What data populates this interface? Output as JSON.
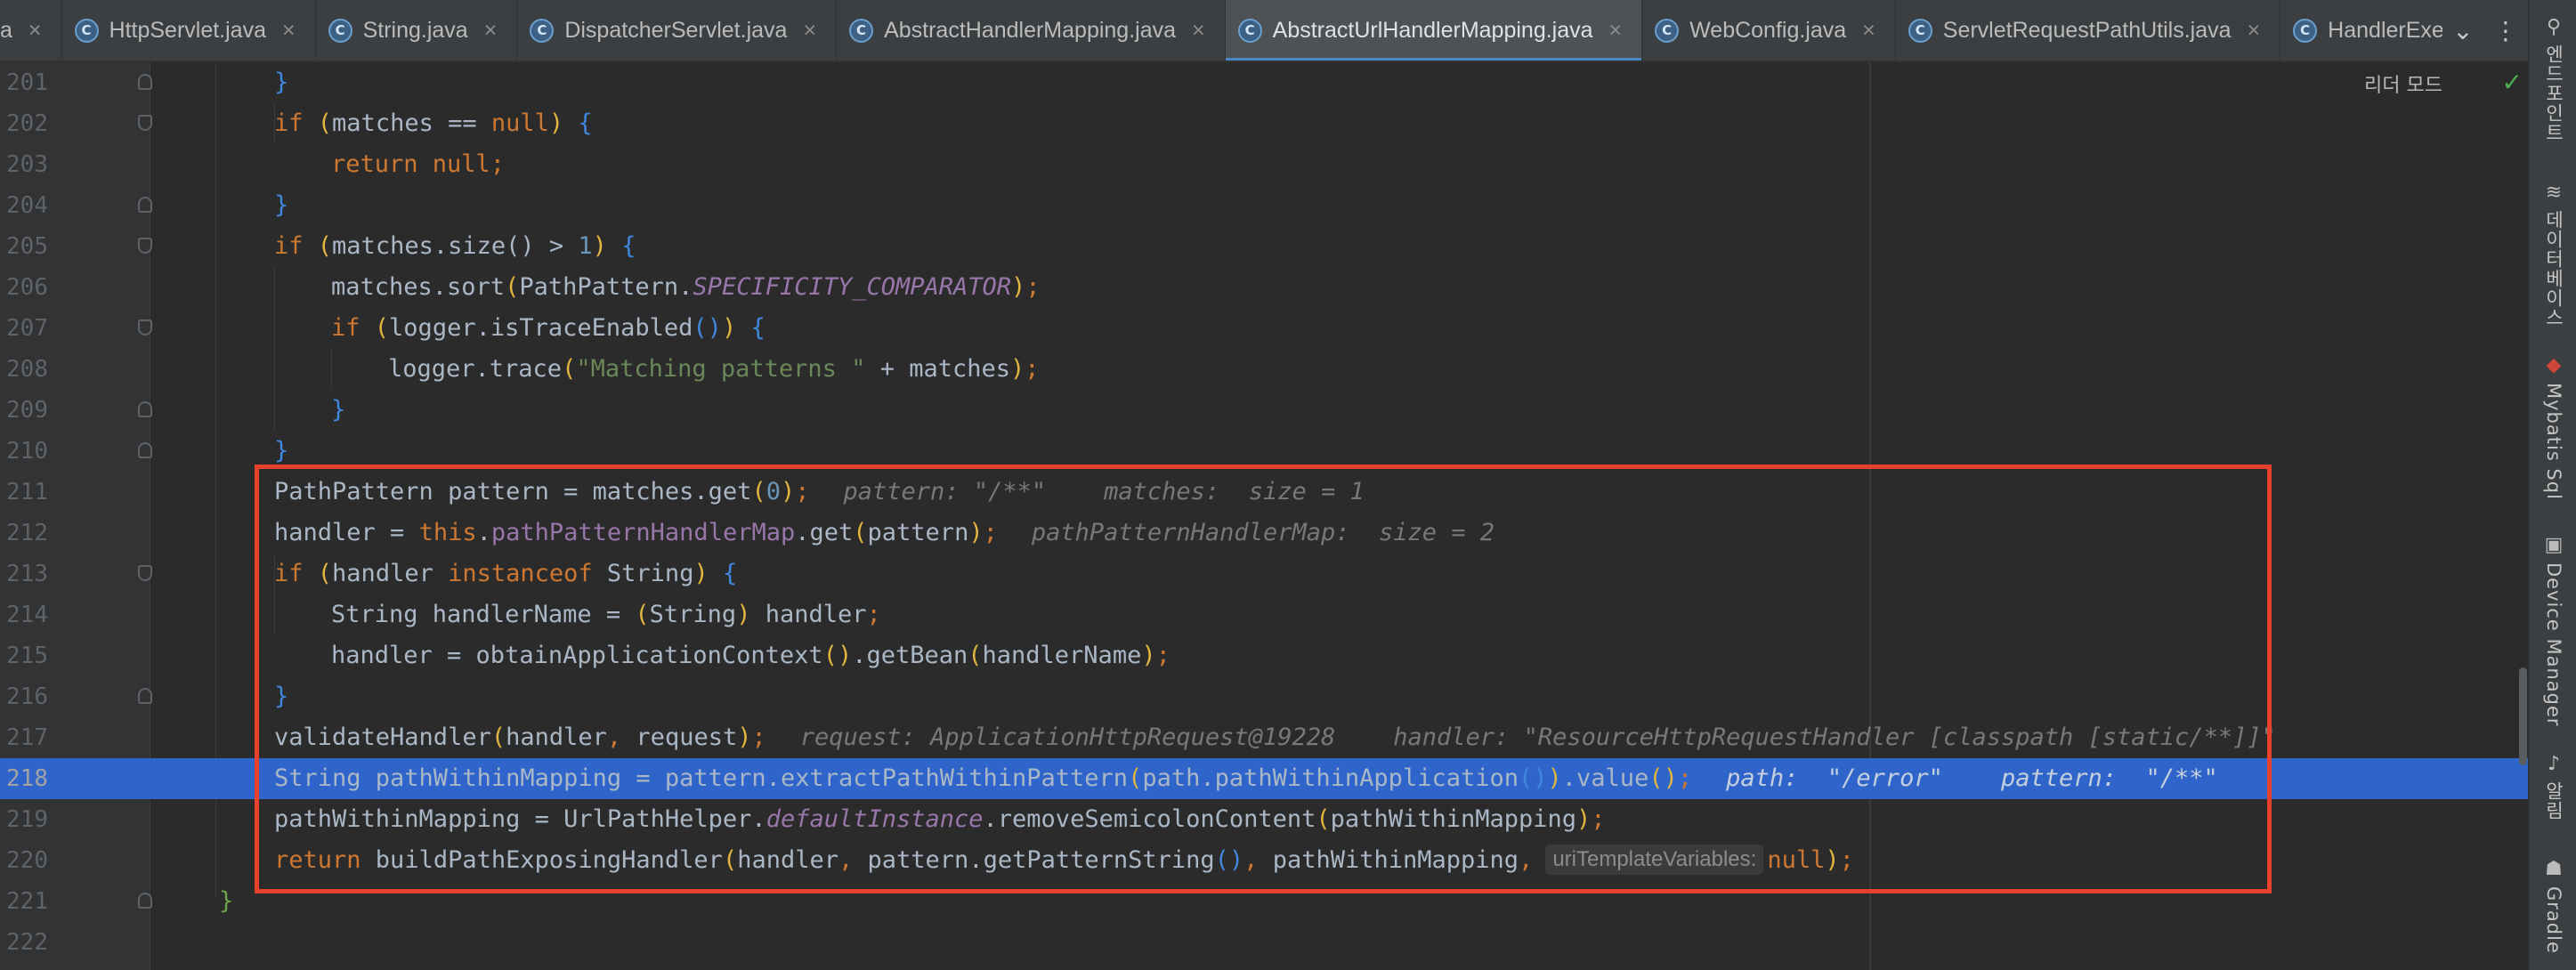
{
  "tabs": [
    {
      "label": "a",
      "icon": "",
      "closable": false,
      "active": false,
      "partial": true
    },
    {
      "label": "HttpServlet.java",
      "icon": "class-icon",
      "closable": true,
      "active": false
    },
    {
      "label": "String.java",
      "icon": "class-icon",
      "closable": true,
      "active": false
    },
    {
      "label": "DispatcherServlet.java",
      "icon": "class-icon",
      "closable": true,
      "active": false
    },
    {
      "label": "AbstractHandlerMapping.java",
      "icon": "abstract-class-icon",
      "closable": true,
      "active": false
    },
    {
      "label": "AbstractUrlHandlerMapping.java",
      "icon": "abstract-class-icon",
      "closable": true,
      "active": true
    },
    {
      "label": "WebConfig.java",
      "icon": "class-icon",
      "closable": true,
      "active": false
    },
    {
      "label": "ServletRequestPathUtils.java",
      "icon": "abstract-class-icon",
      "closable": true,
      "active": false
    },
    {
      "label": "HandlerExecutionChain.java",
      "icon": "class-icon",
      "closable": false,
      "active": false
    }
  ],
  "tab_icon_letter": "C",
  "tab_close_glyph": "×",
  "tab_tools": {
    "dropdown": "⌄",
    "more": "⋮"
  },
  "reader_mode_label": "리더 모드",
  "lines": {
    "l201": "201",
    "l202": "202",
    "l203": "203",
    "l204": "204",
    "l205": "205",
    "l206": "206",
    "l207": "207",
    "l208": "208",
    "l209": "209",
    "l210": "210",
    "l211": "211",
    "l212": "212",
    "l213": "213",
    "l214": "214",
    "l215": "215",
    "l216": "216",
    "l217": "217",
    "l218": "218",
    "l219": "219",
    "l220": "220",
    "l221": "221",
    "l222": "222"
  },
  "hints": {
    "h211_pattern": "pattern:",
    "h211_pattern_val": "\"/**\"",
    "h211_matches": "matches:",
    "h211_matches_val": "size = 1",
    "h212_map": "pathPatternHandlerMap:",
    "h212_map_val": "size = 2",
    "h217_request": "request:",
    "h217_request_val": "ApplicationHttpRequest@19228",
    "h217_handler": "handler:",
    "h217_handler_val": "\"ResourceHttpRequestHandler [classpath [static/**]]\"",
    "h218_path": "path:",
    "h218_path_val": "\"/error\"",
    "h218_pattern": "pattern:",
    "h218_pattern_val": "\"/**\"",
    "h220_inlay": "uriTemplateVariables:"
  },
  "right_tools": [
    {
      "label": "엔드포인트",
      "icon": "endpoints-icon"
    },
    {
      "label": "데이터베이스",
      "icon": "database-icon"
    },
    {
      "label": "Mybatis Sql",
      "icon": "mybatis-icon"
    },
    {
      "label": "Device Manager",
      "icon": "device-manager-icon"
    },
    {
      "label": "알림",
      "icon": "notifications-icon"
    },
    {
      "label": "Gradle",
      "icon": "gradle-icon"
    }
  ],
  "colors": {
    "keyword": "#cc7832",
    "string": "#6a8759",
    "number": "#6897bb",
    "field": "#9876aa",
    "current_line": "#2f65ca",
    "highlight_box": "#e6412b",
    "active_tab_underline": "#4a88c7"
  }
}
